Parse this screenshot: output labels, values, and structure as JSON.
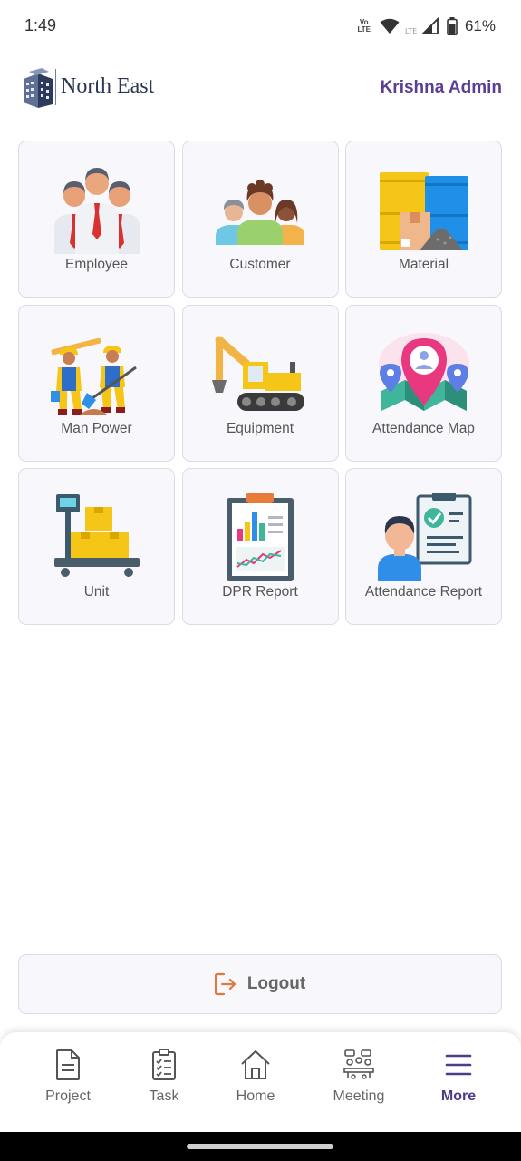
{
  "status": {
    "time": "1:49",
    "volte_top": "Vo",
    "volte_bottom": "LTE",
    "lte": "LTE",
    "battery": "61%"
  },
  "header": {
    "brand": "North East",
    "user": "Krishna Admin"
  },
  "tiles": [
    {
      "label": "Employee",
      "icon": "employee-icon"
    },
    {
      "label": "Customer",
      "icon": "customer-icon"
    },
    {
      "label": "Material",
      "icon": "material-icon"
    },
    {
      "label": "Man Power",
      "icon": "manpower-icon"
    },
    {
      "label": "Equipment",
      "icon": "equipment-icon"
    },
    {
      "label": "Attendance Map",
      "icon": "map-pin-icon"
    },
    {
      "label": "Unit",
      "icon": "unit-scale-icon"
    },
    {
      "label": "DPR Report",
      "icon": "report-clipboard-icon"
    },
    {
      "label": "Attendance Report",
      "icon": "attendance-report-icon"
    }
  ],
  "logout": {
    "label": "Logout",
    "accent": "#e0793a"
  },
  "nav": [
    {
      "label": "Project",
      "icon": "document-icon"
    },
    {
      "label": "Task",
      "icon": "checklist-icon"
    },
    {
      "label": "Home",
      "icon": "home-icon"
    },
    {
      "label": "Meeting",
      "icon": "meeting-icon"
    },
    {
      "label": "More",
      "icon": "menu-icon",
      "active": true
    }
  ],
  "colors": {
    "accent": "#5b3e96",
    "tile_bg": "#f8f7fc",
    "tile_border": "#dcdbe8"
  }
}
